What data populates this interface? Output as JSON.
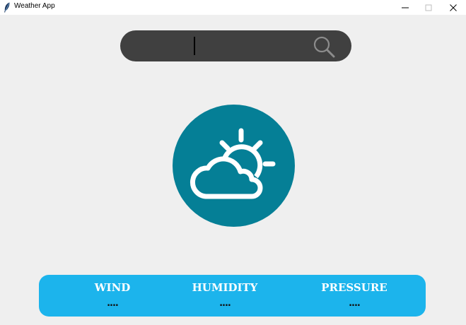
{
  "window": {
    "title": "Weather App"
  },
  "search": {
    "value": ""
  },
  "colors": {
    "accent": "#1cb4ec",
    "logo_circle": "#057f96",
    "search_bg": "#404040",
    "background": "#efefef"
  },
  "icons": {
    "app": "feather-icon",
    "search": "search-icon",
    "weather": "partly-cloudy-icon"
  },
  "metrics": [
    {
      "label": "WIND",
      "value": "...."
    },
    {
      "label": "HUMIDITY",
      "value": "...."
    },
    {
      "label": "PRESSURE",
      "value": "...."
    }
  ]
}
